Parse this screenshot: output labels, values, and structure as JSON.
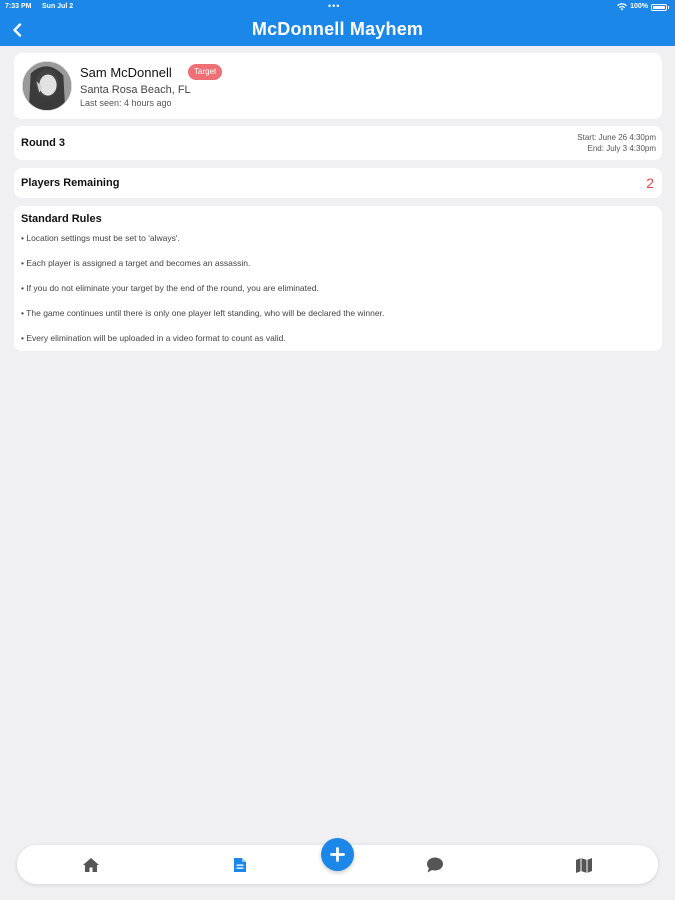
{
  "status_bar": {
    "time": "7:33 PM",
    "date": "Sun Jul 2",
    "dots": "•••",
    "battery_text": "100%"
  },
  "header": {
    "title": "McDonnell Mayhem",
    "back_icon": "chevron-left-icon"
  },
  "profile": {
    "name": "Sam McDonnell",
    "badge": "Target",
    "location": "Santa Rosa Beach, FL",
    "last_seen": "Last seen: 4 hours ago"
  },
  "round": {
    "label": "Round 3",
    "start": "Start: June 26 4:30pm",
    "end": "End: July 3 4:30pm"
  },
  "players": {
    "label": "Players Remaining",
    "count": "2"
  },
  "rules": {
    "title": "Standard Rules",
    "items": [
      "• Location settings must be set to 'always'.",
      "• Each player is assigned a target and becomes an assassin.",
      "• If you do not eliminate your target by the end of the round, you are eliminated.",
      "• The game continues until there is only one player left standing, who will be declared the winner.",
      "• Every elimination will be uploaded in a video format to count as valid."
    ]
  },
  "tabbar": {
    "items": [
      "home-icon",
      "document-icon",
      "plus-icon",
      "chat-icon",
      "map-icon"
    ]
  },
  "colors": {
    "accent": "#1a87e9",
    "badge": "#ef6f74",
    "count": "#e9474b",
    "background": "#f0f0f2"
  }
}
